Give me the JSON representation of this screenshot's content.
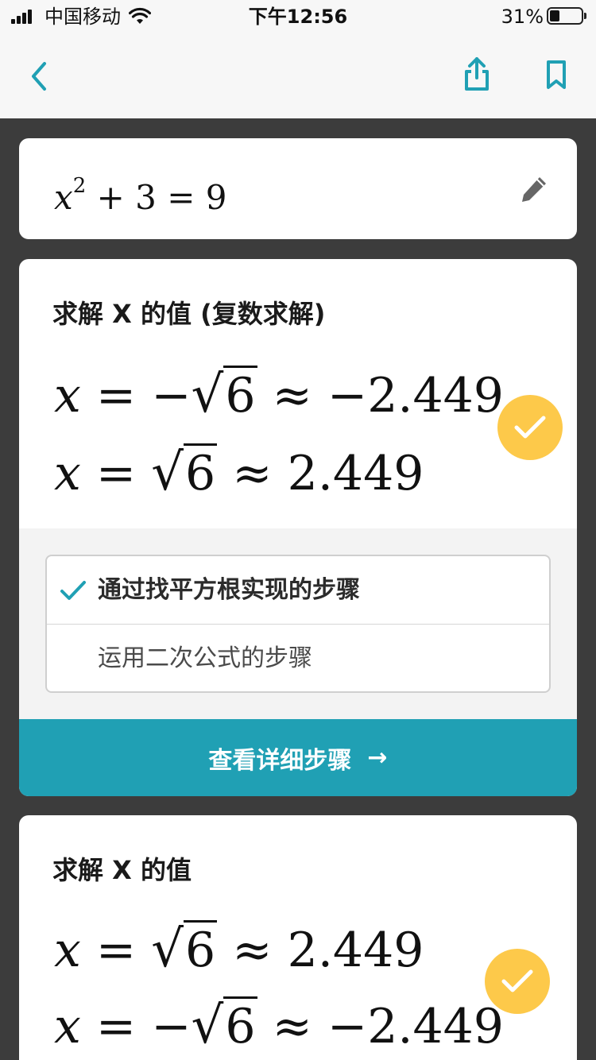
{
  "status_bar": {
    "carrier": "中国移动",
    "time": "下午12:56",
    "battery": "31%",
    "battery_level": 0.31
  },
  "nav": {
    "back_icon": "chevron-left-icon",
    "share_icon": "share-icon",
    "bookmark_icon": "bookmark-icon"
  },
  "equation": {
    "base": "x",
    "exponent": "2",
    "rest": " + 3 = 9",
    "edit_icon": "pencil-icon"
  },
  "solution1": {
    "title": "求解 X 的值 (复数求解)",
    "line1": {
      "var": "x",
      "eq": " = −",
      "radicand": "6",
      "approx": " ≈ −2.449"
    },
    "line2": {
      "var": "x",
      "eq": " = ",
      "radicand": "6",
      "approx": " ≈ 2.449"
    },
    "methods": [
      {
        "label": "通过找平方根实现的步骤",
        "selected": true
      },
      {
        "label": "运用二次公式的步骤",
        "selected": false
      }
    ],
    "steps_button": "查看详细步骤",
    "steps_arrow": "→"
  },
  "solution2": {
    "title": "求解 X 的值",
    "line1": {
      "var": "x",
      "eq": " = ",
      "radicand": "6",
      "approx": " ≈ 2.449"
    },
    "line2": {
      "var": "x",
      "eq": " = −",
      "radicand": "6",
      "approx": " ≈ −2.449"
    }
  },
  "colors": {
    "accent": "#20a0b4",
    "check_badge": "#fdc94a",
    "background": "#3c3c3c"
  }
}
